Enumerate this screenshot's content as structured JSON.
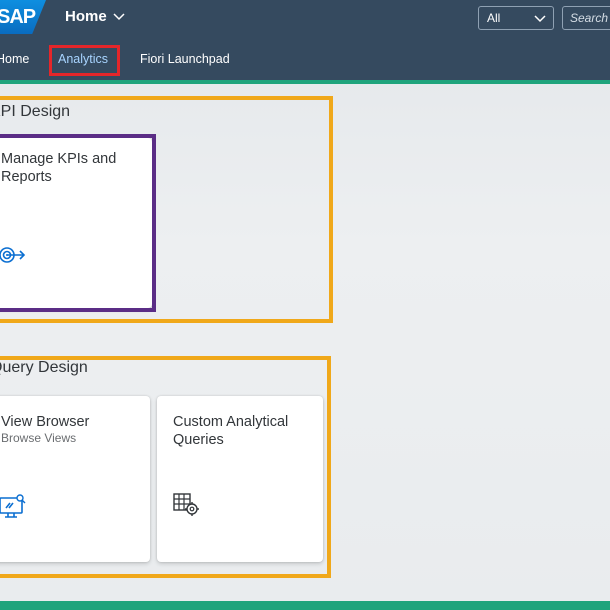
{
  "shell": {
    "logo_text": "SAP",
    "home_title": "Home",
    "scope_value": "All",
    "search_placeholder": "Search"
  },
  "tabs": [
    {
      "label": "Home",
      "active": false
    },
    {
      "label": "Analytics",
      "active": true
    },
    {
      "label": "Fiori Launchpad",
      "active": false
    }
  ],
  "groups": [
    {
      "title": "KPI Design",
      "tiles": [
        {
          "title": "Manage KPIs and Reports",
          "subtitle": "",
          "icon": "target-arrow-icon"
        }
      ]
    },
    {
      "title": "Query Design",
      "tiles": [
        {
          "title": "View Browser",
          "subtitle": "Browse Views",
          "icon": "monitor-search-icon"
        },
        {
          "title": "Custom Analytical Queries",
          "subtitle": "",
          "icon": "table-settings-icon"
        }
      ]
    }
  ],
  "colors": {
    "shell_bg": "#354a5f",
    "accent_green": "#1fa47c",
    "highlight_orange": "#f0a81a",
    "highlight_purple": "#5b2d86",
    "highlight_red": "#e5262a",
    "icon_blue": "#0a6ed1"
  }
}
